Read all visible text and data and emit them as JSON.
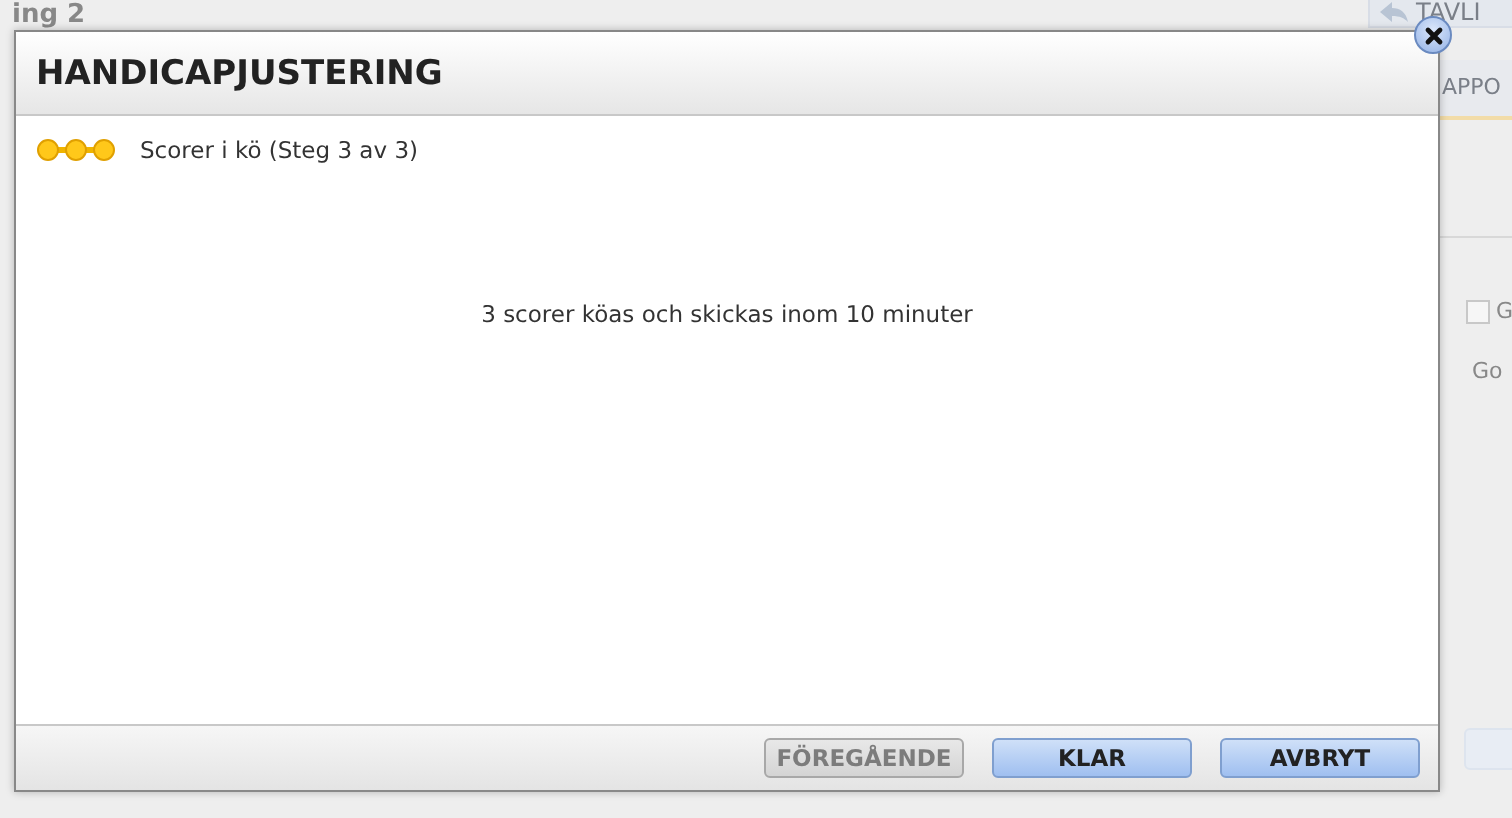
{
  "background": {
    "heading": "ing 2",
    "back_button": "TAVLI",
    "tab": "APPO",
    "checkbox": {
      "label": "G",
      "checked": false
    },
    "column_header": "Go"
  },
  "dialog": {
    "title": "HANDICAPJUSTERING",
    "steps": [
      {
        "done": true
      },
      {
        "done": true
      },
      {
        "done": true
      }
    ],
    "step_label": "Scorer i kö (Steg 3 av 3)",
    "message": "3 scorer köas och skickas inom 10 minuter",
    "buttons": [
      {
        "label": "FÖREGÅENDE",
        "disabled": true
      },
      {
        "label": "KLAR",
        "disabled": false
      },
      {
        "label": "AVBRYT",
        "disabled": false
      }
    ]
  }
}
